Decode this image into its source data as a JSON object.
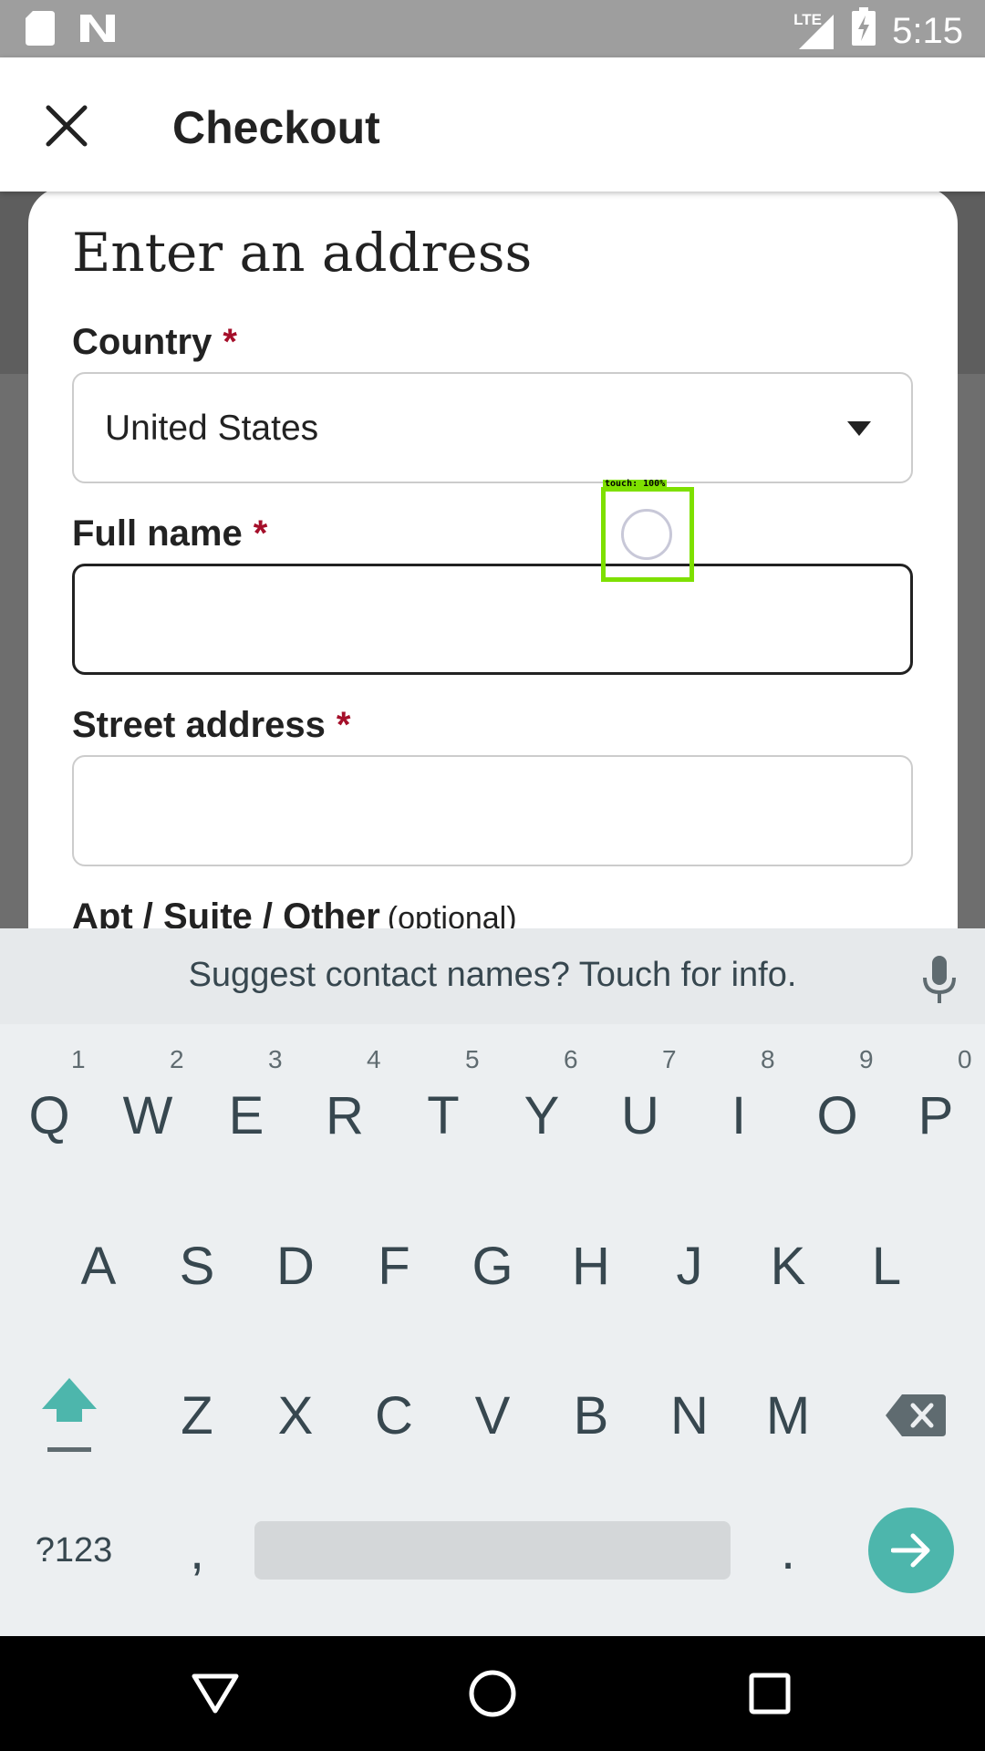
{
  "status_bar": {
    "time": "5:15",
    "network": "LTE",
    "icons": [
      "sd-card-icon",
      "n-logo-icon",
      "signal-icon",
      "battery-icon"
    ]
  },
  "app_bar": {
    "title": "Checkout",
    "close_icon": "close-icon"
  },
  "form": {
    "title": "Enter an address",
    "country_label": "Country",
    "country_value": "United States",
    "required_marker": "*",
    "full_name_label": "Full name",
    "full_name_value": "",
    "street_label": "Street address",
    "street_value": "",
    "apt_label": "Apt / Suite / Other",
    "apt_optional": "(optional)"
  },
  "touch_overlay": {
    "label": "touch: 100%",
    "color": "#7ee000"
  },
  "keyboard": {
    "suggestion": "Suggest contact names? Touch for info.",
    "row1": [
      "Q",
      "W",
      "E",
      "R",
      "T",
      "Y",
      "U",
      "I",
      "O",
      "P"
    ],
    "row1_hints": [
      "1",
      "2",
      "3",
      "4",
      "5",
      "6",
      "7",
      "8",
      "9",
      "0"
    ],
    "row2": [
      "A",
      "S",
      "D",
      "F",
      "G",
      "H",
      "J",
      "K",
      "L"
    ],
    "row3": [
      "Z",
      "X",
      "C",
      "V",
      "B",
      "N",
      "M"
    ],
    "symbols_key": "?123",
    "comma_key": ",",
    "period_key": ".",
    "accent_color": "#4db6ac"
  },
  "nav_bar": {
    "buttons": [
      "back-icon",
      "home-icon",
      "recents-icon"
    ]
  }
}
